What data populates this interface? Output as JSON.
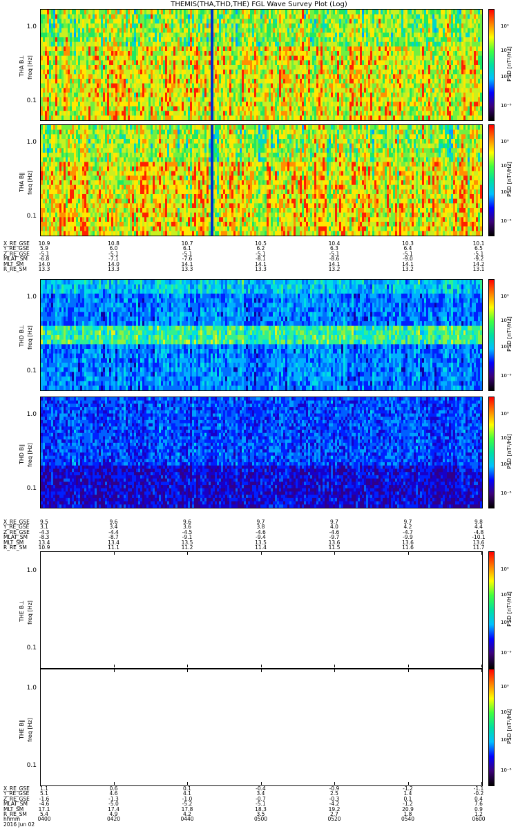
{
  "title": "THEMIS(THA,THD,THE) FGL Wave Survey Plot (Log)",
  "chart_data": {
    "type": "heatmap",
    "colorbar": {
      "label": "PSD [nT²/Hz]",
      "ticks": [
        "10⁰",
        "10⁻²",
        "10⁻⁴",
        "10⁻⁶"
      ],
      "colormap": [
        "#000000",
        "#3b0078",
        "#0000ff",
        "#00c0ff",
        "#00e0a0",
        "#40ff40",
        "#ffff00",
        "#ff8000",
        "#ff0000"
      ]
    },
    "y_ticks": [
      "1.0",
      "0.1"
    ],
    "y_scale": "log",
    "panels": [
      {
        "probe": "THA",
        "component": "B⊥",
        "ylabel": "THA B⊥",
        "ylabel2": "freq [Hz]",
        "style": "tha",
        "band_warm": [
          0.35,
          0.65
        ]
      },
      {
        "probe": "THA",
        "component": "B∥",
        "ylabel": "THA B∥",
        "ylabel2": "freq [Hz]",
        "style": "tha",
        "band_warm": [
          0.55,
          0.85
        ]
      },
      {
        "probe": "THD",
        "component": "B⊥",
        "ylabel": "THD B⊥",
        "ylabel2": "freq [Hz]",
        "style": "thd",
        "band_warm": [
          0.4,
          0.55
        ]
      },
      {
        "probe": "THD",
        "component": "B∥",
        "ylabel": "THD B∥",
        "ylabel2": "freq [Hz]",
        "style": "thd2",
        "band_warm": [
          0.4,
          0.55
        ]
      },
      {
        "probe": "THE",
        "component": "B⊥",
        "ylabel": "THE B⊥",
        "ylabel2": "freq [Hz]",
        "style": "empty"
      },
      {
        "probe": "THE",
        "component": "B∥",
        "ylabel": "THE B∥",
        "ylabel2": "freq [Hz]",
        "style": "empty"
      }
    ],
    "ephemeris": [
      {
        "probe": "THA",
        "rows": [
          {
            "label": "X_RE_GSE",
            "values": [
              "10.9",
              "10.8",
              "10.7",
              "10.5",
              "10.4",
              "10.3",
              "10.1"
            ]
          },
          {
            "label": "Y_RE_GSE",
            "values": [
              "5.9",
              "6.0",
              "6.1",
              "6.2",
              "6.3",
              "6.4",
              "6.5"
            ]
          },
          {
            "label": "Z_RE_GSE",
            "values": [
              "-5.1",
              "-5.1",
              "-5.1",
              "-5.1",
              "-5.1",
              "-5.1",
              "-5.1"
            ]
          },
          {
            "label": "MLAT_SM",
            "values": [
              "-6.8",
              "-7.1",
              "-7.6",
              "-8.1",
              "-8.6",
              "-9.0",
              "-9.2"
            ]
          },
          {
            "label": "MLT_SM",
            "values": [
              "14.0",
              "14.0",
              "14.1",
              "14.1",
              "14.1",
              "14.1",
              "14.2"
            ]
          },
          {
            "label": "R_RE_SM",
            "values": [
              "13.3",
              "13.3",
              "13.3",
              "13.3",
              "13.2",
              "13.2",
              "13.1"
            ]
          }
        ]
      },
      {
        "probe": "THD",
        "rows": [
          {
            "label": "X_RE_GSE",
            "values": [
              "9.5",
              "9.6",
              "9.6",
              "9.7",
              "9.7",
              "9.7",
              "9.8"
            ]
          },
          {
            "label": "Y_RE_GSE",
            "values": [
              "3.1",
              "3.4",
              "3.6",
              "3.8",
              "4.0",
              "4.2",
              "4.4"
            ]
          },
          {
            "label": "Z_RE_GSE",
            "values": [
              "-4.3",
              "-4.4",
              "-4.5",
              "-4.6",
              "-4.6",
              "-4.7",
              "-4.8"
            ]
          },
          {
            "label": "MLAT_SM",
            "values": [
              "-8.3",
              "-8.7",
              "-9.1",
              "-9.4",
              "-9.7",
              "-9.9",
              "-10.1"
            ]
          },
          {
            "label": "MLT_SM",
            "values": [
              "13.4",
              "13.4",
              "13.5",
              "13.5",
              "13.6",
              "13.6",
              "13.6"
            ]
          },
          {
            "label": "R_RE_SM",
            "values": [
              "10.9",
              "11.1",
              "11.2",
              "11.4",
              "11.5",
              "11.6",
              "11.7"
            ]
          }
        ]
      },
      {
        "probe": "THE",
        "rows": [
          {
            "label": "X_RE_GSE",
            "values": [
              "1.1",
              "0.6",
              "0.1",
              "-0.4",
              "-0.9",
              "-1.2",
              "-1.1"
            ]
          },
          {
            "label": "Y_RE_GSE",
            "values": [
              "5.1",
              "4.6",
              "4.1",
              "3.4",
              "2.5",
              "1.4",
              "-0.2"
            ]
          },
          {
            "label": "Z_RE_GSE",
            "values": [
              "-1.6",
              "-1.3",
              "-1.0",
              "-0.7",
              "-0.3",
              "0.1",
              "0.4"
            ]
          },
          {
            "label": "MLAT_SM",
            "values": [
              "-4.6",
              "-5.0",
              "-5.2",
              "-5.1",
              "-4.2",
              "-1.2",
              "7.6"
            ]
          },
          {
            "label": "MLT_SM",
            "values": [
              "17.1",
              "17.4",
              "17.8",
              "18.3",
              "19.2",
              "20.9",
              "0.9"
            ]
          },
          {
            "label": "R_RE_SM",
            "values": [
              "5.4",
              "4.9",
              "4.2",
              "3.5",
              "2.7",
              "1.8",
              "1.2"
            ]
          },
          {
            "label": "hhmm",
            "values": [
              "0400",
              "0420",
              "0440",
              "0500",
              "0520",
              "0540",
              "0600"
            ]
          },
          {
            "label": "2016 Jun 02",
            "values": []
          }
        ]
      }
    ]
  }
}
